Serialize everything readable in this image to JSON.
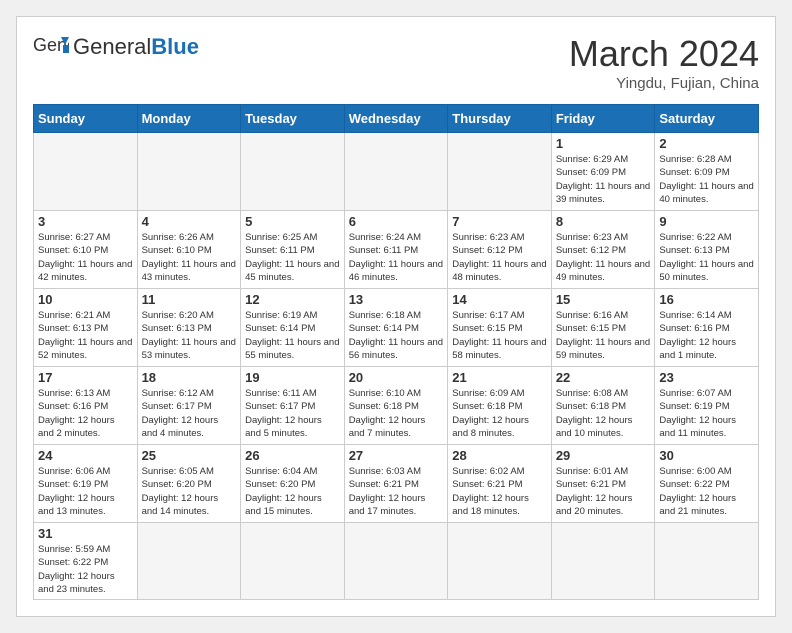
{
  "header": {
    "logo_general": "General",
    "logo_blue": "Blue",
    "month_title": "March 2024",
    "location": "Yingdu, Fujian, China"
  },
  "weekdays": [
    "Sunday",
    "Monday",
    "Tuesday",
    "Wednesday",
    "Thursday",
    "Friday",
    "Saturday"
  ],
  "weeks": [
    [
      {
        "day": "",
        "info": ""
      },
      {
        "day": "",
        "info": ""
      },
      {
        "day": "",
        "info": ""
      },
      {
        "day": "",
        "info": ""
      },
      {
        "day": "",
        "info": ""
      },
      {
        "day": "1",
        "info": "Sunrise: 6:29 AM\nSunset: 6:09 PM\nDaylight: 11 hours and 39 minutes."
      },
      {
        "day": "2",
        "info": "Sunrise: 6:28 AM\nSunset: 6:09 PM\nDaylight: 11 hours and 40 minutes."
      }
    ],
    [
      {
        "day": "3",
        "info": "Sunrise: 6:27 AM\nSunset: 6:10 PM\nDaylight: 11 hours and 42 minutes."
      },
      {
        "day": "4",
        "info": "Sunrise: 6:26 AM\nSunset: 6:10 PM\nDaylight: 11 hours and 43 minutes."
      },
      {
        "day": "5",
        "info": "Sunrise: 6:25 AM\nSunset: 6:11 PM\nDaylight: 11 hours and 45 minutes."
      },
      {
        "day": "6",
        "info": "Sunrise: 6:24 AM\nSunset: 6:11 PM\nDaylight: 11 hours and 46 minutes."
      },
      {
        "day": "7",
        "info": "Sunrise: 6:23 AM\nSunset: 6:12 PM\nDaylight: 11 hours and 48 minutes."
      },
      {
        "day": "8",
        "info": "Sunrise: 6:23 AM\nSunset: 6:12 PM\nDaylight: 11 hours and 49 minutes."
      },
      {
        "day": "9",
        "info": "Sunrise: 6:22 AM\nSunset: 6:13 PM\nDaylight: 11 hours and 50 minutes."
      }
    ],
    [
      {
        "day": "10",
        "info": "Sunrise: 6:21 AM\nSunset: 6:13 PM\nDaylight: 11 hours and 52 minutes."
      },
      {
        "day": "11",
        "info": "Sunrise: 6:20 AM\nSunset: 6:13 PM\nDaylight: 11 hours and 53 minutes."
      },
      {
        "day": "12",
        "info": "Sunrise: 6:19 AM\nSunset: 6:14 PM\nDaylight: 11 hours and 55 minutes."
      },
      {
        "day": "13",
        "info": "Sunrise: 6:18 AM\nSunset: 6:14 PM\nDaylight: 11 hours and 56 minutes."
      },
      {
        "day": "14",
        "info": "Sunrise: 6:17 AM\nSunset: 6:15 PM\nDaylight: 11 hours and 58 minutes."
      },
      {
        "day": "15",
        "info": "Sunrise: 6:16 AM\nSunset: 6:15 PM\nDaylight: 11 hours and 59 minutes."
      },
      {
        "day": "16",
        "info": "Sunrise: 6:14 AM\nSunset: 6:16 PM\nDaylight: 12 hours and 1 minute."
      }
    ],
    [
      {
        "day": "17",
        "info": "Sunrise: 6:13 AM\nSunset: 6:16 PM\nDaylight: 12 hours and 2 minutes."
      },
      {
        "day": "18",
        "info": "Sunrise: 6:12 AM\nSunset: 6:17 PM\nDaylight: 12 hours and 4 minutes."
      },
      {
        "day": "19",
        "info": "Sunrise: 6:11 AM\nSunset: 6:17 PM\nDaylight: 12 hours and 5 minutes."
      },
      {
        "day": "20",
        "info": "Sunrise: 6:10 AM\nSunset: 6:18 PM\nDaylight: 12 hours and 7 minutes."
      },
      {
        "day": "21",
        "info": "Sunrise: 6:09 AM\nSunset: 6:18 PM\nDaylight: 12 hours and 8 minutes."
      },
      {
        "day": "22",
        "info": "Sunrise: 6:08 AM\nSunset: 6:18 PM\nDaylight: 12 hours and 10 minutes."
      },
      {
        "day": "23",
        "info": "Sunrise: 6:07 AM\nSunset: 6:19 PM\nDaylight: 12 hours and 11 minutes."
      }
    ],
    [
      {
        "day": "24",
        "info": "Sunrise: 6:06 AM\nSunset: 6:19 PM\nDaylight: 12 hours and 13 minutes."
      },
      {
        "day": "25",
        "info": "Sunrise: 6:05 AM\nSunset: 6:20 PM\nDaylight: 12 hours and 14 minutes."
      },
      {
        "day": "26",
        "info": "Sunrise: 6:04 AM\nSunset: 6:20 PM\nDaylight: 12 hours and 15 minutes."
      },
      {
        "day": "27",
        "info": "Sunrise: 6:03 AM\nSunset: 6:21 PM\nDaylight: 12 hours and 17 minutes."
      },
      {
        "day": "28",
        "info": "Sunrise: 6:02 AM\nSunset: 6:21 PM\nDaylight: 12 hours and 18 minutes."
      },
      {
        "day": "29",
        "info": "Sunrise: 6:01 AM\nSunset: 6:21 PM\nDaylight: 12 hours and 20 minutes."
      },
      {
        "day": "30",
        "info": "Sunrise: 6:00 AM\nSunset: 6:22 PM\nDaylight: 12 hours and 21 minutes."
      }
    ],
    [
      {
        "day": "31",
        "info": "Sunrise: 5:59 AM\nSunset: 6:22 PM\nDaylight: 12 hours and 23 minutes."
      },
      {
        "day": "",
        "info": ""
      },
      {
        "day": "",
        "info": ""
      },
      {
        "day": "",
        "info": ""
      },
      {
        "day": "",
        "info": ""
      },
      {
        "day": "",
        "info": ""
      },
      {
        "day": "",
        "info": ""
      }
    ]
  ]
}
